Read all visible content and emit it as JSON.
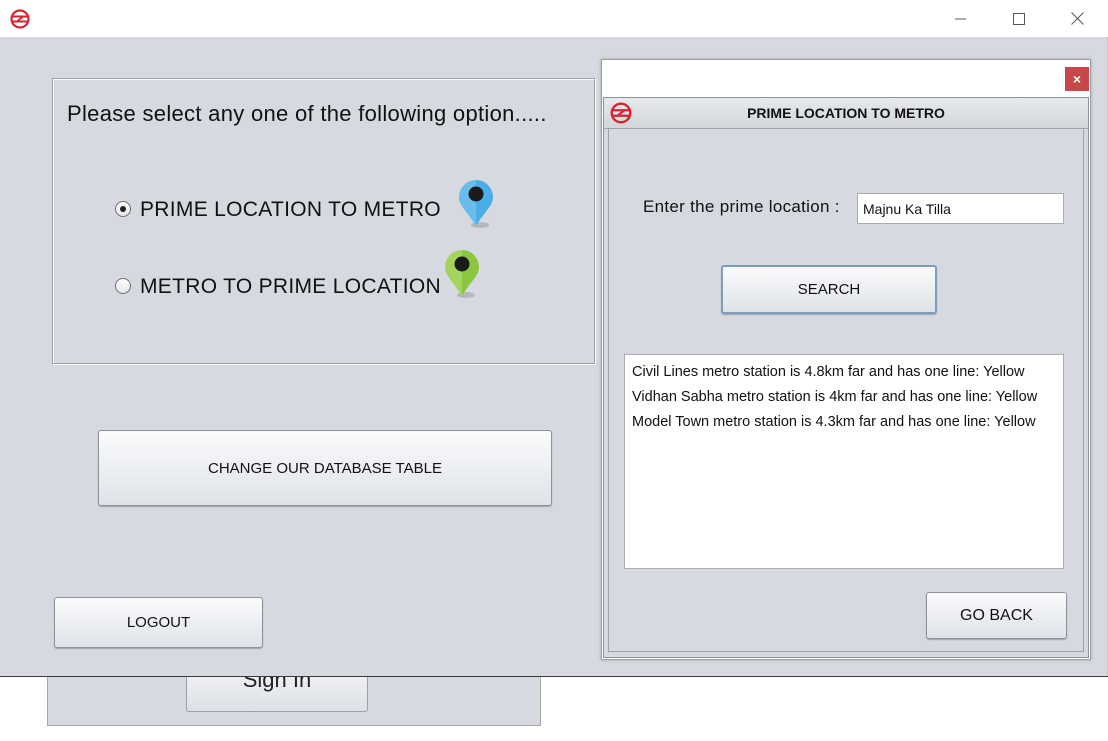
{
  "main": {
    "options_title": "Please select any one of the following option.....",
    "options": [
      {
        "label": "PRIME LOCATION TO METRO",
        "selected": true,
        "pin_color": "#4aaee6"
      },
      {
        "label": "METRO TO PRIME LOCATION",
        "selected": false,
        "pin_color": "#8cc63e"
      }
    ],
    "change_db_label": "CHANGE OUR DATABASE TABLE",
    "logout_label": "LOGOUT"
  },
  "background_window": {
    "sign_in_label": "Sign In"
  },
  "dialog": {
    "title": "PRIME LOCATION TO METRO",
    "close_label": "×",
    "field_label": "Enter the prime location :",
    "location_value": "Majnu Ka Tilla",
    "search_label": "SEARCH",
    "results": [
      "Civil Lines metro station is 4.8km far and has one line: Yellow",
      "Vidhan Sabha metro station is 4km far and has one line: Yellow",
      "Model Town metro station is 4.3km far and has one line: Yellow"
    ],
    "go_back_label": "GO BACK"
  },
  "colors": {
    "logo_red": "#d22630",
    "window_bg": "#d6d9df",
    "close_red": "#c9474b"
  },
  "icons": [
    "metro-logo-icon",
    "minimize-icon",
    "maximize-icon",
    "close-icon",
    "map-pin-icon"
  ]
}
